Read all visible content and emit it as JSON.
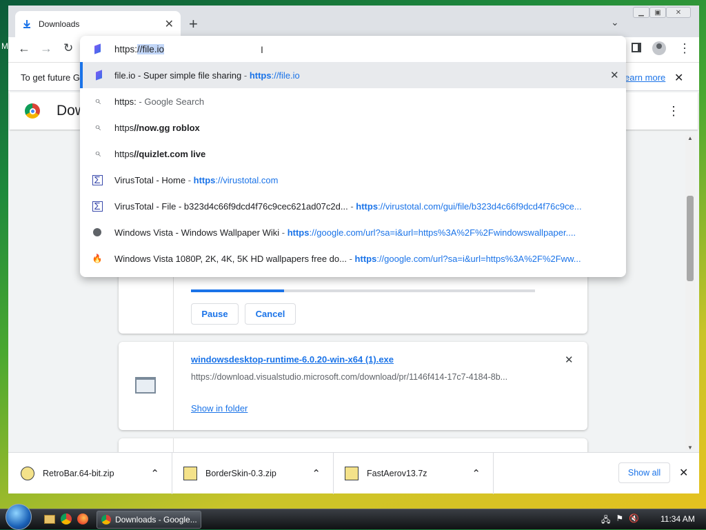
{
  "window": {
    "tab_title": "Downloads",
    "new_tab": "+"
  },
  "toolbar": {
    "address_prefix": "https:",
    "address_selected": "//file.io"
  },
  "infobar": {
    "text": "To get future G",
    "learn_more": "earn more"
  },
  "downloads": {
    "title": "Dow"
  },
  "omnibox": {
    "suggestions": [
      {
        "icon": "file-io-icon",
        "title": "file.io - Super simple file sharing",
        "sep": " - ",
        "bold": "https",
        "rest": "://file.io",
        "is_url": true
      },
      {
        "icon": "search-icon",
        "title": "https:",
        "sep": "",
        "bold": "",
        "rest": " - Google Search",
        "is_url": false
      },
      {
        "icon": "search-icon",
        "title": "https ",
        "sep": "",
        "bold": "//now.gg roblox",
        "rest": "",
        "is_url": false
      },
      {
        "icon": "search-icon",
        "title": "https ",
        "sep": "",
        "bold": "//quizlet.com live",
        "rest": "",
        "is_url": false
      },
      {
        "icon": "virustotal-icon",
        "title": "VirusTotal - Home",
        "sep": " - ",
        "bold": "https",
        "rest": "://virustotal.com",
        "is_url": true
      },
      {
        "icon": "virustotal-icon",
        "title": "VirusTotal - File - b323d4c66f9dcd4f76c9cec621ad07c2d...",
        "sep": " - ",
        "bold": "https",
        "rest": "://virustotal.com/gui/file/b323d4c66f9dcd4f76c9ce...",
        "is_url": true
      },
      {
        "icon": "globe-icon",
        "title": "Windows Vista - Windows Wallpaper Wiki",
        "sep": " - ",
        "bold": "https",
        "rest": "://google.com/url?sa=i&url=https%3A%2F%2Fwindowswallpaper....",
        "is_url": true
      },
      {
        "icon": "flame-icon",
        "title": "Windows Vista 1080P, 2K, 4K, 5K HD wallpapers free do...",
        "sep": " - ",
        "bold": "https",
        "rest": "://google.com/url?sa=i&url=https%3A%2F%2Fww...",
        "is_url": true
      }
    ]
  },
  "card1": {
    "pause": "Pause",
    "cancel": "Cancel",
    "progress": 0.27
  },
  "card2": {
    "filename": "windowsdesktop-runtime-6.0.20-win-x64 (1).exe",
    "url": "https://download.visualstudio.microsoft.com/download/pr/1146f414-17c7-4184-8b...",
    "show_in_folder": "Show in folder"
  },
  "shelf": {
    "items": [
      "RetroBar.64-bit.zip",
      "BorderSkin-0.3.zip",
      "FastAerov13.7z"
    ],
    "show_all": "Show all"
  },
  "taskbar": {
    "task": "Downloads - Google...",
    "clock": "11:34 AM",
    "desktop_letter": "M"
  }
}
